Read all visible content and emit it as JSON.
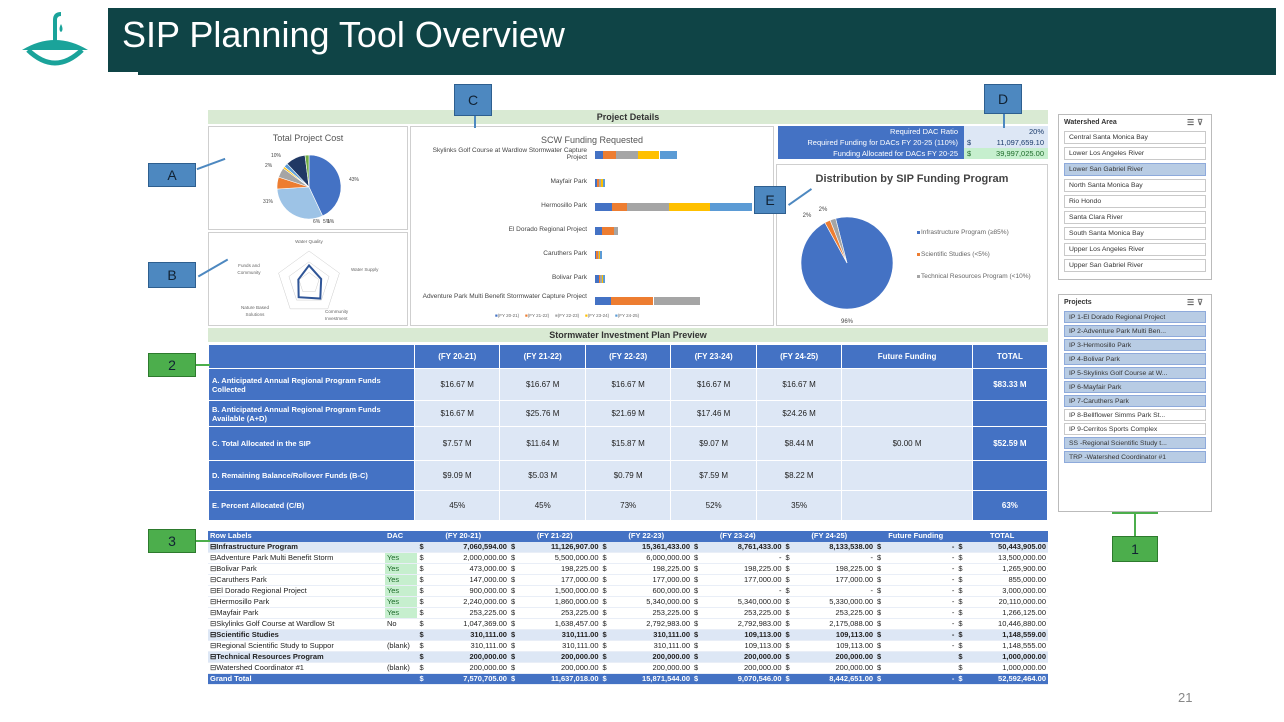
{
  "slide": {
    "title": "SIP Planning Tool Overview",
    "page_number": "21",
    "logo_icon": "umbrella-water-drop-icon"
  },
  "callouts": {
    "a": "A",
    "b": "B",
    "c": "C",
    "d": "D",
    "e": "E",
    "n1": "1",
    "n2": "2",
    "n3": "3"
  },
  "dashboard": {
    "project_details_band": "Project Details",
    "sip_preview_band": "Stormwater Investment Plan Preview",
    "total_cost": {
      "title": "Total Project Cost",
      "labels": [
        "10%",
        "2%",
        "43%",
        "31%",
        "6%",
        "5%",
        "1%"
      ],
      "slices": [
        43,
        31,
        6,
        5,
        1,
        2,
        10,
        2
      ],
      "colors": [
        "#4472c4",
        "#9dc3e6",
        "#ed7d31",
        "#a5a5a5",
        "#ffc000",
        "#5b9bd5",
        "#203864",
        "#70ad47"
      ]
    },
    "radar": {
      "axes": [
        "Water Quality",
        "Water Supply",
        "Community Investment",
        "Nature Based Solutions",
        "Funds and Community"
      ],
      "values": [
        0.55,
        0.4,
        0.6,
        0.55,
        0.35
      ]
    },
    "scw": {
      "title": "SCW Funding Requested",
      "projects": [
        "Skylinks Golf Course at Wardlow Stormwater Capture Project",
        "Mayfair Park",
        "Hermosillo Park",
        "El Dorado Regional Project",
        "Caruthers Park",
        "Bolivar Park",
        "Adventure Park Multi Benefit Stormwater Capture Project"
      ],
      "years": [
        "(FY 20-21)",
        "(FY 21-22)",
        "(FY 22-23)",
        "(FY 23-24)",
        "(FY 24-25)"
      ],
      "colors": [
        "#4472c4",
        "#ed7d31",
        "#a5a5a5",
        "#ffc000",
        "#5b9bd5"
      ],
      "values": [
        [
          1.05,
          1.64,
          2.79,
          2.79,
          2.18
        ],
        [
          0.25,
          0.25,
          0.25,
          0.25,
          0.25
        ],
        [
          2.24,
          1.86,
          5.34,
          5.34,
          5.33
        ],
        [
          0.9,
          1.5,
          0.6,
          0,
          0
        ],
        [
          0.15,
          0.18,
          0.18,
          0.18,
          0.18
        ],
        [
          0.47,
          0.2,
          0.2,
          0.2,
          0.2
        ],
        [
          2.0,
          5.5,
          6.0,
          0,
          0
        ]
      ],
      "xmax": 20
    },
    "dac": {
      "rows": [
        {
          "label": "Required DAC Ratio",
          "cur": "",
          "value": "20%"
        },
        {
          "label": "Required Funding for DACs FY 20-25 (110%)",
          "cur": "$",
          "value": "11,097,659.10"
        },
        {
          "label": "Funding Allocated for DACs FY 20-25",
          "cur": "$",
          "value": "39,997,025.00"
        }
      ]
    },
    "dist": {
      "title": "Distribution by SIP Funding Program",
      "slices": [
        96,
        2,
        2
      ],
      "colors": [
        "#4472c4",
        "#ed7d31",
        "#a5a5a5"
      ],
      "labels": [
        "96%",
        "2%",
        "2%"
      ],
      "legend": [
        "Infrastructure Program (≥85%)",
        "Scientific Studies (<5%)",
        "Technical Resources Program (<10%)"
      ]
    },
    "sip": {
      "headers": [
        "",
        "(FY 20-21)",
        "(FY 21-22)",
        "(FY 22-23)",
        "(FY 23-24)",
        "(FY 24-25)",
        "Future Funding",
        "TOTAL"
      ],
      "rows": [
        [
          "A. Anticipated Annual Regional Program Funds Collected",
          "$16.67 M",
          "$16.67 M",
          "$16.67 M",
          "$16.67 M",
          "$16.67 M",
          "",
          "$83.33 M"
        ],
        [
          "B. Anticipated Annual Regional Program Funds Available (A+D)",
          "$16.67 M",
          "$25.76 M",
          "$21.69 M",
          "$17.46 M",
          "$24.26 M",
          "",
          ""
        ],
        [
          "C. Total Allocated in the SIP",
          "$7.57 M",
          "$11.64 M",
          "$15.87 M",
          "$9.07 M",
          "$8.44 M",
          "$0.00 M",
          "$52.59 M"
        ],
        [
          "D. Remaining Balance/Rollover Funds (B-C)",
          "$9.09 M",
          "$5.03 M",
          "$0.79 M",
          "$7.59 M",
          "$8.22 M",
          "",
          ""
        ],
        [
          "E. Percent Allocated (C/B)",
          "45%",
          "45%",
          "73%",
          "52%",
          "35%",
          "",
          "63%"
        ]
      ]
    },
    "pivot": {
      "headers": [
        "Row Labels",
        "DAC",
        "(FY 20-21)",
        "(FY 21-22)",
        "(FY 22-23)",
        "(FY 23-24)",
        "(FY 24-25)",
        "Future Funding",
        "TOTAL"
      ],
      "rows": [
        {
          "t": "grp",
          "n": "⊟Infrastructure Program",
          "d": "",
          "v": [
            "7,060,594.00",
            "11,126,907.00",
            "15,361,433.00",
            "8,761,433.00",
            "8,133,538.00",
            "-",
            "50,443,905.00"
          ]
        },
        {
          "t": "row",
          "n": "  ⊟Adventure Park Multi Benefit Storm",
          "d": "Yes",
          "v": [
            "2,000,000.00",
            "5,500,000.00",
            "6,000,000.00",
            "-",
            "-",
            "-",
            "13,500,000.00"
          ]
        },
        {
          "t": "row",
          "n": "  ⊟Bolivar Park",
          "d": "Yes",
          "v": [
            "473,000.00",
            "198,225.00",
            "198,225.00",
            "198,225.00",
            "198,225.00",
            "-",
            "1,265,900.00"
          ]
        },
        {
          "t": "row",
          "n": "  ⊟Caruthers Park",
          "d": "Yes",
          "v": [
            "147,000.00",
            "177,000.00",
            "177,000.00",
            "177,000.00",
            "177,000.00",
            "-",
            "855,000.00"
          ]
        },
        {
          "t": "row",
          "n": "  ⊟El Dorado Regional Project",
          "d": "Yes",
          "v": [
            "900,000.00",
            "1,500,000.00",
            "600,000.00",
            "-",
            "-",
            "-",
            "3,000,000.00"
          ]
        },
        {
          "t": "row",
          "n": "  ⊟Hermosillo Park",
          "d": "Yes",
          "v": [
            "2,240,000.00",
            "1,860,000.00",
            "5,340,000.00",
            "5,340,000.00",
            "5,330,000.00",
            "-",
            "20,110,000.00"
          ]
        },
        {
          "t": "row",
          "n": "  ⊟Mayfair Park",
          "d": "Yes",
          "v": [
            "253,225.00",
            "253,225.00",
            "253,225.00",
            "253,225.00",
            "253,225.00",
            "-",
            "1,266,125.00"
          ]
        },
        {
          "t": "row",
          "n": "  ⊟Skylinks Golf Course at Wardlow St",
          "d": "No",
          "v": [
            "1,047,369.00",
            "1,638,457.00",
            "2,792,983.00",
            "2,792,983.00",
            "2,175,088.00",
            "-",
            "10,446,880.00"
          ]
        },
        {
          "t": "grp",
          "n": "⊟Scientific Studies",
          "d": "",
          "v": [
            "310,111.00",
            "310,111.00",
            "310,111.00",
            "109,113.00",
            "109,113.00",
            "-",
            "1,148,559.00"
          ]
        },
        {
          "t": "row",
          "n": "  ⊟Regional Scientific Study to Suppor",
          "d": "(blank)",
          "v": [
            "310,111.00",
            "310,111.00",
            "310,111.00",
            "109,113.00",
            "109,113.00",
            "-",
            "1,148,555.00"
          ]
        },
        {
          "t": "grp",
          "n": "⊟Technical Resources Program",
          "d": "",
          "v": [
            "200,000.00",
            "200,000.00",
            "200,000.00",
            "200,000.00",
            "200,000.00",
            "",
            "1,000,000.00"
          ]
        },
        {
          "t": "row",
          "n": "  ⊟Watershed Coordinator #1",
          "d": "(blank)",
          "v": [
            "200,000.00",
            "200,000.00",
            "200,000.00",
            "200,000.00",
            "200,000.00",
            "",
            "1,000,000.00"
          ]
        },
        {
          "t": "gt",
          "n": "Grand Total",
          "d": "",
          "v": [
            "7,570,705.00",
            "11,637,018.00",
            "15,871,544.00",
            "9,070,546.00",
            "8,442,651.00",
            "-",
            "52,592,464.00"
          ]
        }
      ]
    }
  },
  "slicer_watershed": {
    "title": "Watershed Area",
    "items": [
      "Central Santa Monica Bay",
      "Lower Los Angeles River",
      "Lower San Gabriel River",
      "North Santa Monica Bay",
      "Rio Hondo",
      "Santa Clara River",
      "South Santa Monica Bay",
      "Upper Los Angeles River",
      "Upper San Gabriel River"
    ],
    "selected": [
      2
    ]
  },
  "slicer_projects": {
    "title": "Projects",
    "items": [
      "IP 1-El Dorado Regional Project",
      "IP 2-Adventure Park Multi Ben...",
      "IP 3-Hermosillo Park",
      "IP 4-Bolivar Park",
      "IP 5-Skylinks Golf Course at W...",
      "IP 6-Mayfair Park",
      "IP 7-Caruthers Park",
      "IP 8-Bellflower Simms Park St...",
      "IP 9-Cerritos Sports Complex",
      "SS -Regional Scientific Study t...",
      "TRP -Watershed Coordinator #1"
    ],
    "selected": [
      0,
      1,
      2,
      3,
      4,
      5,
      6,
      9,
      10
    ]
  }
}
